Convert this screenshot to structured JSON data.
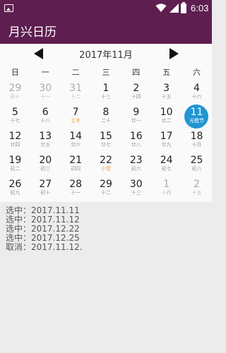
{
  "status_bar": {
    "time": "6:03",
    "icons": [
      "image-icon",
      "wifi-icon",
      "signal-icon",
      "battery-icon"
    ]
  },
  "app_bar": {
    "title": "月兴日历"
  },
  "calendar": {
    "month_title": "2017年11月",
    "weekdays": [
      "日",
      "一",
      "二",
      "三",
      "四",
      "五",
      "六"
    ],
    "weeks": [
      [
        {
          "num": "29",
          "lunar": "初十",
          "other": true
        },
        {
          "num": "30",
          "lunar": "十一",
          "other": true
        },
        {
          "num": "31",
          "lunar": "十二",
          "other": true
        },
        {
          "num": "1",
          "lunar": "十三"
        },
        {
          "num": "2",
          "lunar": "十四"
        },
        {
          "num": "3",
          "lunar": "十五"
        },
        {
          "num": "4",
          "lunar": "十六"
        }
      ],
      [
        {
          "num": "5",
          "lunar": "十七"
        },
        {
          "num": "6",
          "lunar": "十八"
        },
        {
          "num": "7",
          "lunar": "立冬",
          "term": true
        },
        {
          "num": "8",
          "lunar": "二十"
        },
        {
          "num": "9",
          "lunar": "廿一"
        },
        {
          "num": "10",
          "lunar": "廿二"
        },
        {
          "num": "11",
          "lunar": "光棍节",
          "selected": true
        }
      ],
      [
        {
          "num": "12",
          "lunar": "廿四"
        },
        {
          "num": "13",
          "lunar": "廿五"
        },
        {
          "num": "14",
          "lunar": "廿六"
        },
        {
          "num": "15",
          "lunar": "廿七"
        },
        {
          "num": "16",
          "lunar": "廿八"
        },
        {
          "num": "17",
          "lunar": "廿九"
        },
        {
          "num": "18",
          "lunar": "十月"
        }
      ],
      [
        {
          "num": "19",
          "lunar": "初二"
        },
        {
          "num": "20",
          "lunar": "初三"
        },
        {
          "num": "21",
          "lunar": "初四"
        },
        {
          "num": "22",
          "lunar": "小雪",
          "term": true
        },
        {
          "num": "23",
          "lunar": "初六"
        },
        {
          "num": "24",
          "lunar": "初七"
        },
        {
          "num": "25",
          "lunar": "初八"
        }
      ],
      [
        {
          "num": "26",
          "lunar": "初九"
        },
        {
          "num": "27",
          "lunar": "初十"
        },
        {
          "num": "28",
          "lunar": "十一"
        },
        {
          "num": "29",
          "lunar": "十二"
        },
        {
          "num": "30",
          "lunar": "十三"
        },
        {
          "num": "1",
          "lunar": "十四",
          "other": true
        },
        {
          "num": "2",
          "lunar": "十五",
          "other": true
        }
      ]
    ]
  },
  "log": [
    "选中：2017.11.11",
    "选中：2017.11.12",
    "选中：2017.12.22",
    "选中：2017.12.25",
    "取消：2017.11.12."
  ]
}
